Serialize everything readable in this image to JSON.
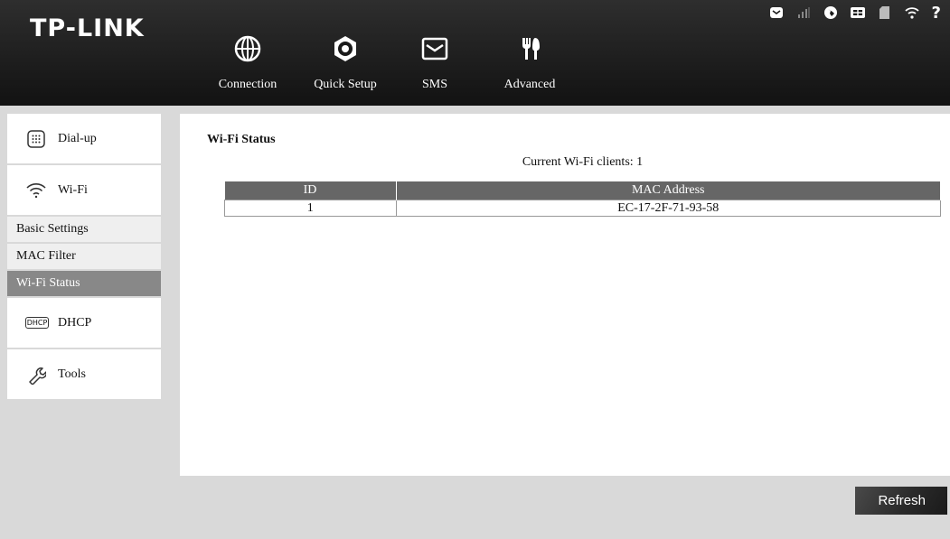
{
  "header": {
    "logo": "TP-LINK",
    "nav": [
      {
        "label": "Connection",
        "icon": "globe-icon"
      },
      {
        "label": "Quick Setup",
        "icon": "quick-setup-icon"
      },
      {
        "label": "SMS",
        "icon": "envelope-icon"
      },
      {
        "label": "Advanced",
        "icon": "tools-icon"
      }
    ],
    "status_icons": [
      "message-icon",
      "signal-icon",
      "internet-icon",
      "sim-icon",
      "sd-card-icon",
      "wifi-icon",
      "help-icon"
    ],
    "help_label": "?"
  },
  "sidebar": {
    "items": [
      {
        "label": "Dial-up",
        "icon": "dialup-icon"
      },
      {
        "label": "Wi-Fi",
        "icon": "wifi-icon"
      },
      {
        "label": "DHCP",
        "icon": "dhcp-icon",
        "icon_text": "DHCP"
      },
      {
        "label": "Tools",
        "icon": "wrench-icon"
      }
    ],
    "wifi_sub": [
      {
        "label": "Basic Settings"
      },
      {
        "label": "MAC Filter"
      },
      {
        "label": "Wi-Fi Status",
        "active": true
      }
    ]
  },
  "main": {
    "title": "Wi-Fi Status",
    "clients_text": "Current Wi-Fi clients: 1",
    "table": {
      "headers": [
        "ID",
        "MAC Address"
      ],
      "rows": [
        [
          "1",
          "EC-17-2F-71-93-58"
        ]
      ]
    }
  },
  "refresh_label": "Refresh",
  "colors": {
    "header_bg": "#1a1a1a",
    "page_bg": "#d9d9d9",
    "table_header_bg": "#666666",
    "active_sub_bg": "#888888"
  }
}
